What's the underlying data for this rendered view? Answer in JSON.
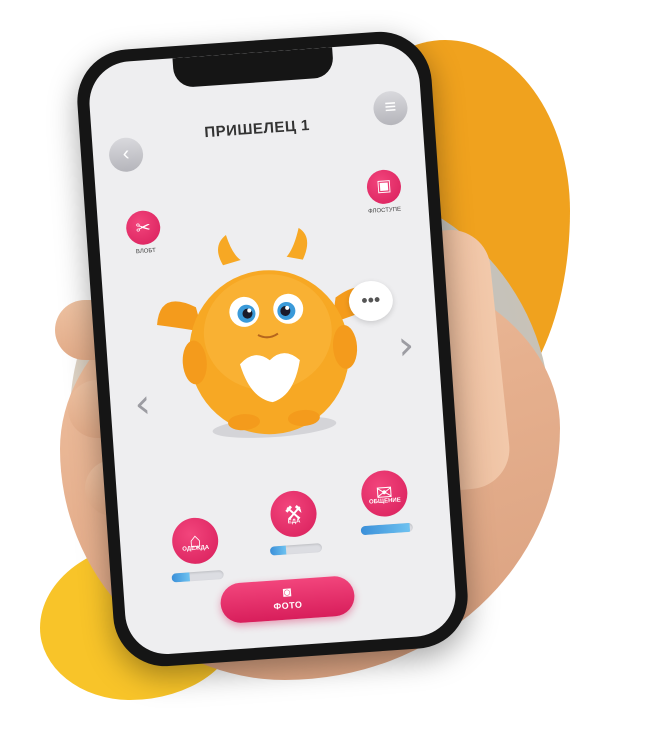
{
  "app": {
    "title": "ПРИШЕЛЕЦ 1"
  },
  "top_buttons": {
    "settings_label": "ВЛОБТ",
    "bag_label": "ФЛОСТУПЕ"
  },
  "stats": [
    {
      "label": "ОДЕЖДА",
      "icon": "hanger-icon",
      "level": 0.35
    },
    {
      "label": "ЕДА",
      "icon": "fork-knife-icon",
      "level": 0.3
    },
    {
      "label": "ОБЩЕНИЕ",
      "icon": "chat-bubbles-icon",
      "level": 0.95
    }
  ],
  "photo_button": {
    "label": "ФОТО",
    "icon": "camera-icon"
  },
  "colors": {
    "accent_pink": "#e0256a",
    "blob_orange": "#f0a21e",
    "blob_yellow": "#f8c429",
    "bar_blue": "#3a8fd9",
    "monster_orange": "#f7a824"
  }
}
